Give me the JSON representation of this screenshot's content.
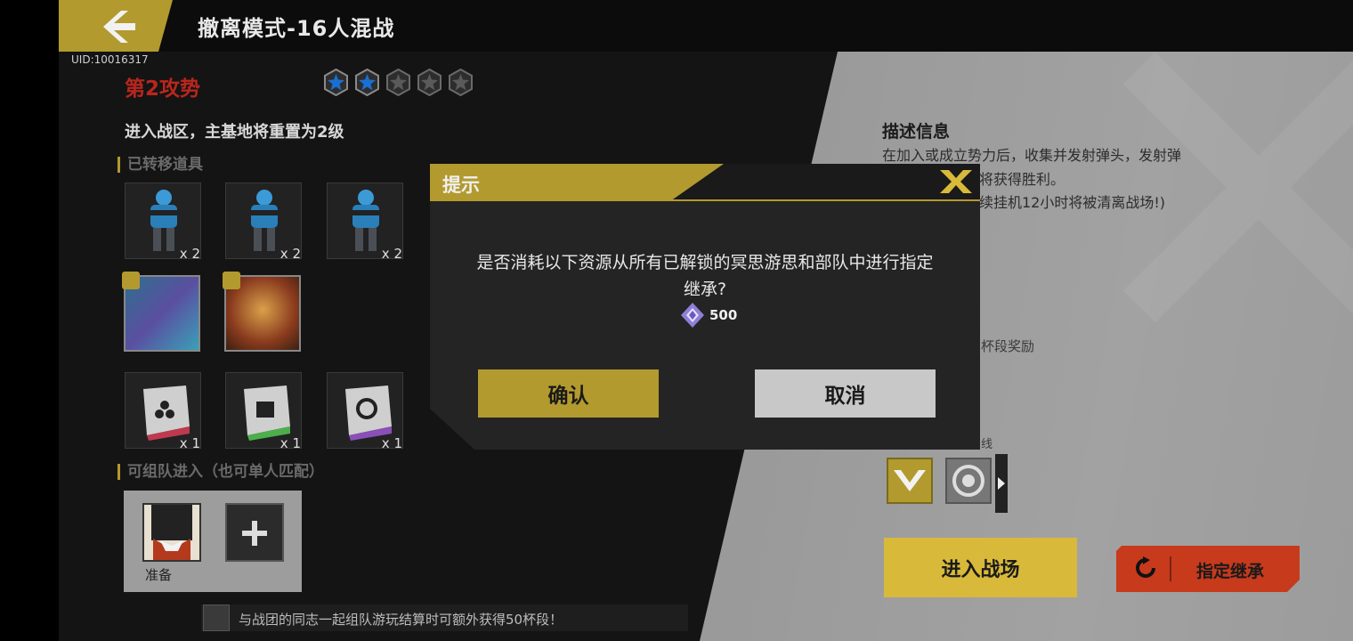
{
  "header": {
    "title": "撤离模式-16人混战",
    "uid": "UID:10016317"
  },
  "stage": {
    "title": "第2攻势",
    "stars_filled": 2,
    "stars_total": 5,
    "reset_text": "进入战区，主基地将重置为2级"
  },
  "transferred": {
    "label": "已转移道具",
    "soldiers": [
      {
        "count": "x 2"
      },
      {
        "count": "x 2"
      },
      {
        "count": "x 2"
      }
    ],
    "boxes": [
      {
        "count": "x 1"
      },
      {
        "count": "x 1"
      },
      {
        "count": "x 1"
      }
    ]
  },
  "team": {
    "label": "可组队进入（也可单人匹配）",
    "ready_text": "准备"
  },
  "tip": {
    "text": "与战团的同志一起组队游玩结算时可额外获得50杯段！"
  },
  "description": {
    "title": "描述信息",
    "lines": [
      "在加入或成立势力后，收集并发射弹头，发射弹",
      "将获得胜利。",
      "续挂机12小时将被清离战场!)"
    ],
    "reward_fragment": "杯段奖励",
    "route_fragment": "线"
  },
  "actions": {
    "enter_label": "进入战场",
    "inherit_label": "指定继承"
  },
  "modal": {
    "title": "提示",
    "message_line1": "是否消耗以下资源从所有已解锁的冥思游思和部队中进行指定",
    "message_line2": "继承?",
    "cost_value": "500",
    "confirm_label": "确认",
    "cancel_label": "取消"
  },
  "colors": {
    "gold": "#b39a2e",
    "red_title": "#b9261d",
    "inherit_red": "#c73a1c",
    "star_blue": "#1a6fd1"
  }
}
